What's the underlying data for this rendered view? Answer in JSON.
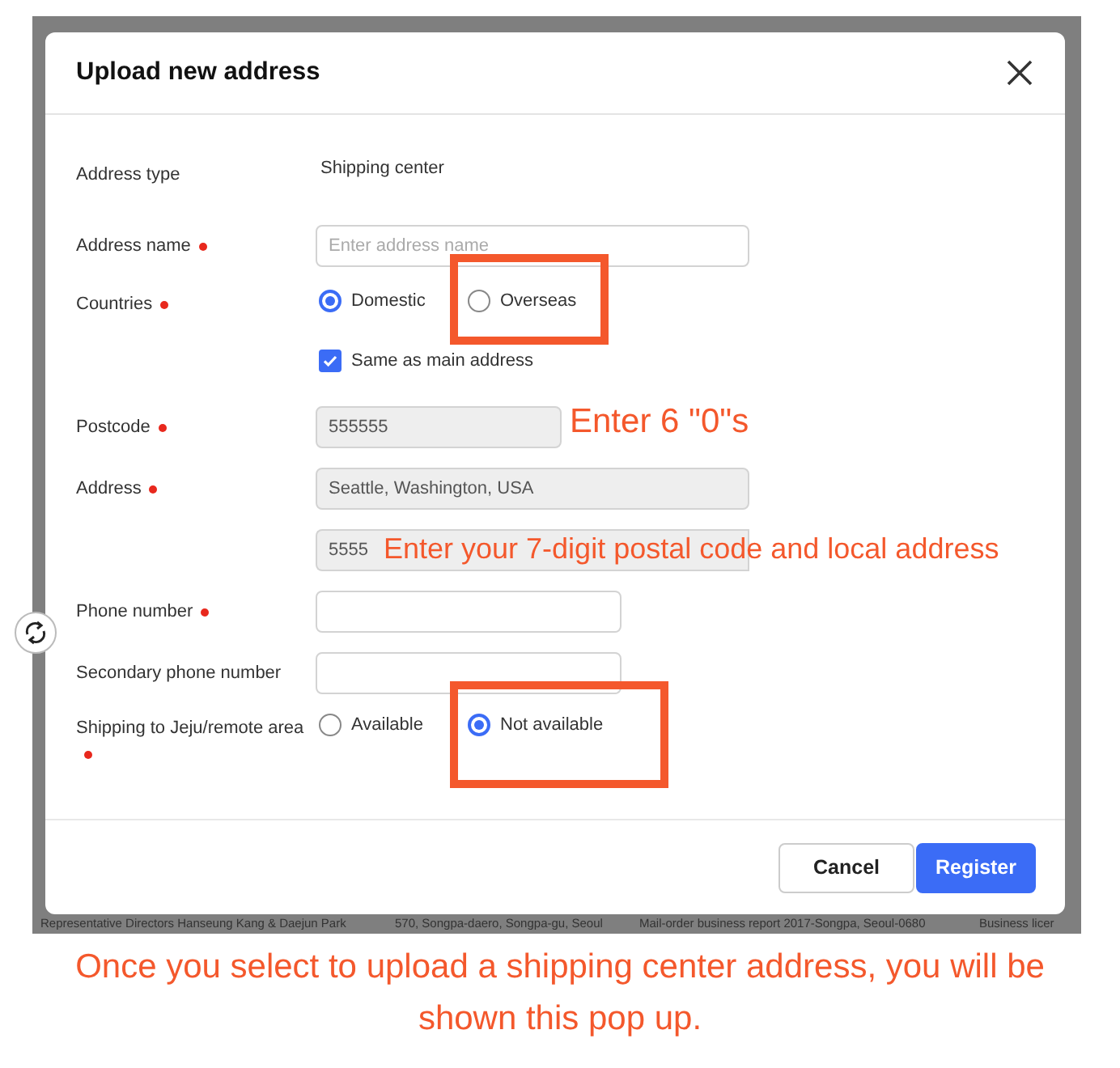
{
  "dialog": {
    "title": "Upload new address",
    "fields": [
      {
        "kind": "text",
        "label": "Address type",
        "required": false,
        "value": "Shipping center"
      },
      {
        "kind": "input",
        "label": "Address name",
        "required": true,
        "placeholder": "Enter address name",
        "disabled": false
      },
      {
        "kind": "radio",
        "label": "Countries",
        "required": true,
        "options": [
          {
            "label": "Domestic",
            "selected": true,
            "highlighted": false
          },
          {
            "label": "Overseas",
            "selected": false,
            "highlighted": true
          }
        ]
      },
      {
        "kind": "checkbox",
        "text": "Same as main address",
        "checked": true
      },
      {
        "kind": "input",
        "label": "Postcode",
        "required": true,
        "value": "555555",
        "disabled": true,
        "note": "Enter 6 \"0\"s"
      },
      {
        "kind": "input",
        "label": "Address",
        "required": true,
        "value": "Seattle, Washington, USA",
        "disabled": true
      },
      {
        "kind": "input",
        "value": "5555",
        "disabled": true,
        "note": "Enter your 7-digit postal code and local address"
      },
      {
        "kind": "input",
        "label": "Phone number",
        "required": true,
        "disabled": false
      },
      {
        "kind": "input",
        "label": "Secondary phone number",
        "required": false,
        "disabled": false
      },
      {
        "kind": "radio",
        "label": "Shipping to Jeju/remote area",
        "required": true,
        "options": [
          {
            "label": "Available",
            "selected": false,
            "highlighted": false
          },
          {
            "label": "Not available",
            "selected": true,
            "highlighted": true
          }
        ]
      }
    ],
    "buttons": [
      {
        "label": "Cancel",
        "kind": "secondary"
      },
      {
        "label": "Register",
        "kind": "primary"
      }
    ]
  },
  "page_footer": [
    "Representative Directors Hanseung Kang & Daejun Park",
    "570, Songpa-daero, Songpa-gu, Seoul",
    "Mail-order business report 2017-Songpa, Seoul-0680",
    "Business licer"
  ],
  "caption": "Once you select to upload a shipping center address, you will be shown this pop up."
}
